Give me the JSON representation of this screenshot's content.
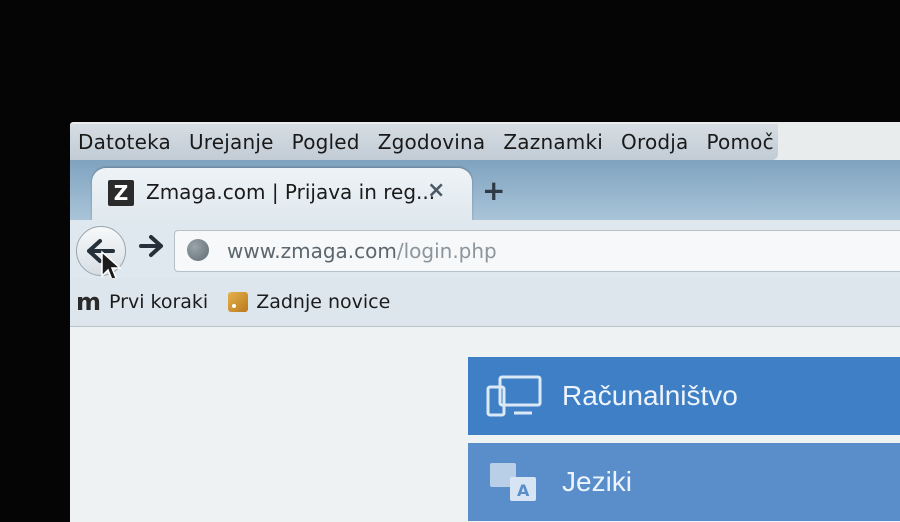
{
  "menu": [
    "Datoteka",
    "Urejanje",
    "Pogled",
    "Zgodovina",
    "Zaznamki",
    "Orodja",
    "Pomoč"
  ],
  "tab": {
    "favicon": "Z",
    "title": "Zmaga.com | Prijava in reg...",
    "close": "×",
    "newtab": "+"
  },
  "nav": {
    "url_host": "www.zmaga.com",
    "url_path": "/login.php"
  },
  "bookmarks": {
    "first_icon": "m",
    "first": "Prvi koraki",
    "second": "Zadnje novice"
  },
  "categories": [
    "Računalništvo",
    "Jeziki"
  ]
}
